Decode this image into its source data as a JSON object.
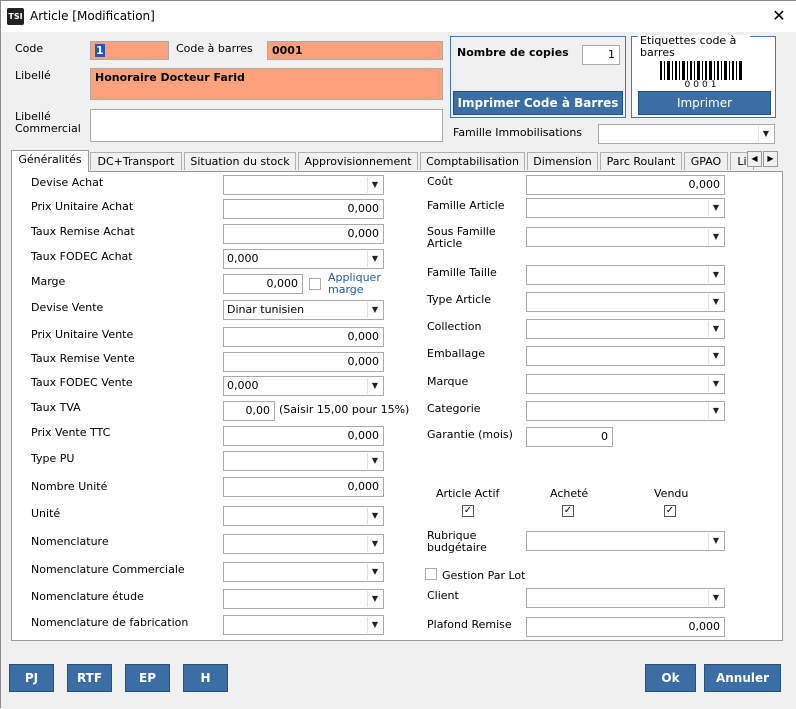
{
  "window": {
    "title": "Article [Modification]",
    "app_icon": "TSI"
  },
  "header": {
    "code_label": "Code",
    "code_value": "1",
    "barcode_label": "Code à barres",
    "barcode_value": "0001",
    "libelle_label": "Libellé",
    "libelle_value": "Honoraire Docteur Farid",
    "libelle_commercial_label": "Libellé Commercial",
    "libelle_commercial_value": "",
    "copies_label": "Nombre de copies",
    "copies_value": "1",
    "print_barcode_btn": "Imprimer Code à Barres",
    "labels_group_title": "Etiquettes code à barres",
    "barcode_image_text": "0001",
    "print_btn": "Imprimer",
    "famille_immo_label": "Famille Immobilisations",
    "famille_immo_value": ""
  },
  "tabs": [
    "Généralités",
    "DC+Transport",
    "Situation du stock",
    "Approvisionnement",
    "Comptabilisation",
    "Dimension",
    "Parc Roulant",
    "GPAO",
    "Li"
  ],
  "left": {
    "devise_achat": {
      "label": "Devise Achat",
      "value": ""
    },
    "pu_achat": {
      "label": "Prix Unitaire Achat",
      "value": "0,000"
    },
    "taux_remise_achat": {
      "label": "Taux Remise Achat",
      "value": "0,000"
    },
    "taux_fodec_achat": {
      "label": "Taux FODEC Achat",
      "value": "0,000"
    },
    "marge": {
      "label": "Marge",
      "value": "0,000",
      "checkbox_label": "Appliquer marge"
    },
    "devise_vente": {
      "label": "Devise Vente",
      "value": "Dinar tunisien"
    },
    "pu_vente": {
      "label": "Prix Unitaire Vente",
      "value": "0,000"
    },
    "taux_remise_vente": {
      "label": "Taux Remise Vente",
      "value": "0,000"
    },
    "taux_fodec_vente": {
      "label": "Taux FODEC Vente",
      "value": "0,000"
    },
    "taux_tva": {
      "label": "Taux TVA",
      "value": "0,00",
      "hint": "(Saisir 15,00 pour 15%)"
    },
    "prix_vente_ttc": {
      "label": "Prix Vente TTC",
      "value": "0,000"
    },
    "type_pu": {
      "label": "Type PU",
      "value": ""
    },
    "nombre_unite": {
      "label": "Nombre Unité",
      "value": "0,000"
    },
    "unite": {
      "label": "Unité",
      "value": ""
    },
    "nomenclature": {
      "label": "Nomenclature",
      "value": ""
    },
    "nomenclature_commerciale": {
      "label": "Nomenclature Commerciale",
      "value": ""
    },
    "nomenclature_etude": {
      "label": "Nomenclature étude",
      "value": ""
    },
    "nomenclature_fabrication": {
      "label": "Nomenclature de fabrication",
      "value": ""
    }
  },
  "right": {
    "cout": {
      "label": "Coût",
      "value": "0,000"
    },
    "famille_article": {
      "label": "Famille Article",
      "value": ""
    },
    "sous_famille_article": {
      "label": "Sous Famille Article",
      "value": ""
    },
    "famille_taille": {
      "label": "Famille Taille",
      "value": ""
    },
    "type_article": {
      "label": "Type Article",
      "value": ""
    },
    "collection": {
      "label": "Collection",
      "value": ""
    },
    "emballage": {
      "label": "Emballage",
      "value": ""
    },
    "marque": {
      "label": "Marque",
      "value": ""
    },
    "categorie": {
      "label": "Categorie",
      "value": ""
    },
    "garantie": {
      "label": "Garantie (mois)",
      "value": "0"
    },
    "article_actif_label": "Article Actif",
    "achete_label": "Acheté",
    "vendu_label": "Vendu",
    "check_mark": "✓",
    "rubrique": {
      "label": "Rubrique budgétaire",
      "value": ""
    },
    "gestion_lot_label": "Gestion Par Lot",
    "client": {
      "label": "Client",
      "value": ""
    },
    "plafond_remise": {
      "label": "Plafond Remise",
      "value": "0,000"
    }
  },
  "footer": {
    "pj": "PJ",
    "rtf": "RTF",
    "ep": "EP",
    "h": "H",
    "ok": "Ok",
    "annuler": "Annuler"
  },
  "glyphs": {
    "dropdown": "▼",
    "tab_left": "◀",
    "tab_right": "▶",
    "close": "✕"
  },
  "colors": {
    "required_field": "#fea17c",
    "button_blue": "#3a6ea5",
    "group_border": "#3b78c2"
  }
}
